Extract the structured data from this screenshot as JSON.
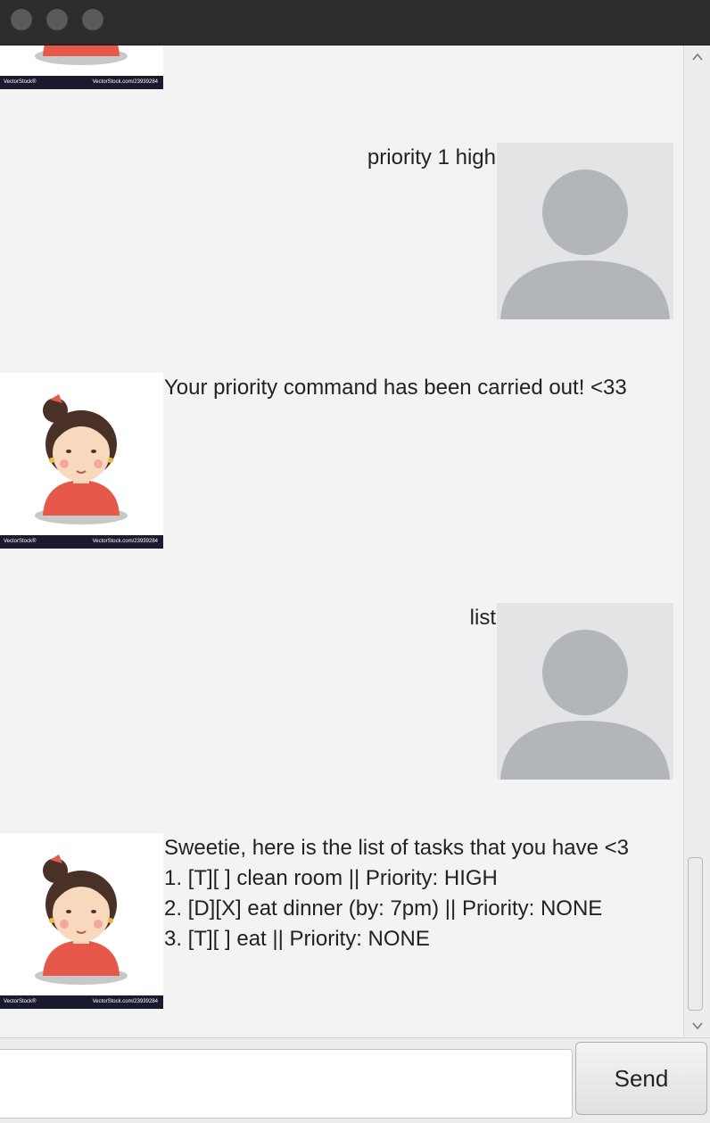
{
  "window": {
    "controls": [
      "close-button",
      "minimize-button",
      "zoom-button"
    ]
  },
  "messages": [
    {
      "from": "bot",
      "text": ""
    },
    {
      "from": "user",
      "text": "priority 1 high"
    },
    {
      "from": "bot",
      "text": "Your priority command has been carried out! <33"
    },
    {
      "from": "user",
      "text": "list"
    },
    {
      "from": "bot",
      "lines": [
        "Sweetie, here is the list of tasks that you have <3",
        "1. [T][ ] clean room || Priority: HIGH",
        "2. [D][X] eat dinner (by: 7pm) || Priority: NONE",
        "3. [T][ ] eat || Priority: NONE"
      ]
    }
  ],
  "avatar": {
    "footer_brand": "VectorStock®",
    "footer_url": "VectorStock.com/23939284"
  },
  "input": {
    "value": "",
    "placeholder": ""
  },
  "send_label": "Send",
  "colors": {
    "titlebar": "#2e2d2b",
    "chat_bg": "#f3f3f3",
    "user_avatar_bg": "#e4e4e6",
    "user_avatar_fg": "#b2b6bb",
    "bot_shirt": "#e5584a",
    "bot_hair": "#4a3128"
  }
}
